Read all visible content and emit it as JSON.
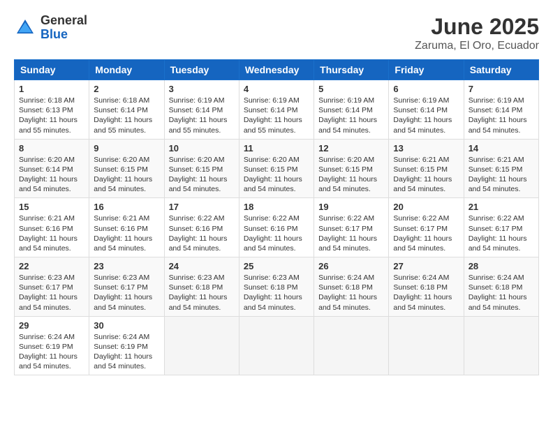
{
  "header": {
    "logo_general": "General",
    "logo_blue": "Blue",
    "month_title": "June 2025",
    "location": "Zaruma, El Oro, Ecuador"
  },
  "days_of_week": [
    "Sunday",
    "Monday",
    "Tuesday",
    "Wednesday",
    "Thursday",
    "Friday",
    "Saturday"
  ],
  "weeks": [
    [
      {
        "day": "1",
        "sunrise": "6:18 AM",
        "sunset": "6:13 PM",
        "daylight": "11 hours and 55 minutes."
      },
      {
        "day": "2",
        "sunrise": "6:18 AM",
        "sunset": "6:14 PM",
        "daylight": "11 hours and 55 minutes."
      },
      {
        "day": "3",
        "sunrise": "6:19 AM",
        "sunset": "6:14 PM",
        "daylight": "11 hours and 55 minutes."
      },
      {
        "day": "4",
        "sunrise": "6:19 AM",
        "sunset": "6:14 PM",
        "daylight": "11 hours and 55 minutes."
      },
      {
        "day": "5",
        "sunrise": "6:19 AM",
        "sunset": "6:14 PM",
        "daylight": "11 hours and 54 minutes."
      },
      {
        "day": "6",
        "sunrise": "6:19 AM",
        "sunset": "6:14 PM",
        "daylight": "11 hours and 54 minutes."
      },
      {
        "day": "7",
        "sunrise": "6:19 AM",
        "sunset": "6:14 PM",
        "daylight": "11 hours and 54 minutes."
      }
    ],
    [
      {
        "day": "8",
        "sunrise": "6:20 AM",
        "sunset": "6:14 PM",
        "daylight": "11 hours and 54 minutes."
      },
      {
        "day": "9",
        "sunrise": "6:20 AM",
        "sunset": "6:15 PM",
        "daylight": "11 hours and 54 minutes."
      },
      {
        "day": "10",
        "sunrise": "6:20 AM",
        "sunset": "6:15 PM",
        "daylight": "11 hours and 54 minutes."
      },
      {
        "day": "11",
        "sunrise": "6:20 AM",
        "sunset": "6:15 PM",
        "daylight": "11 hours and 54 minutes."
      },
      {
        "day": "12",
        "sunrise": "6:20 AM",
        "sunset": "6:15 PM",
        "daylight": "11 hours and 54 minutes."
      },
      {
        "day": "13",
        "sunrise": "6:21 AM",
        "sunset": "6:15 PM",
        "daylight": "11 hours and 54 minutes."
      },
      {
        "day": "14",
        "sunrise": "6:21 AM",
        "sunset": "6:15 PM",
        "daylight": "11 hours and 54 minutes."
      }
    ],
    [
      {
        "day": "15",
        "sunrise": "6:21 AM",
        "sunset": "6:16 PM",
        "daylight": "11 hours and 54 minutes."
      },
      {
        "day": "16",
        "sunrise": "6:21 AM",
        "sunset": "6:16 PM",
        "daylight": "11 hours and 54 minutes."
      },
      {
        "day": "17",
        "sunrise": "6:22 AM",
        "sunset": "6:16 PM",
        "daylight": "11 hours and 54 minutes."
      },
      {
        "day": "18",
        "sunrise": "6:22 AM",
        "sunset": "6:16 PM",
        "daylight": "11 hours and 54 minutes."
      },
      {
        "day": "19",
        "sunrise": "6:22 AM",
        "sunset": "6:17 PM",
        "daylight": "11 hours and 54 minutes."
      },
      {
        "day": "20",
        "sunrise": "6:22 AM",
        "sunset": "6:17 PM",
        "daylight": "11 hours and 54 minutes."
      },
      {
        "day": "21",
        "sunrise": "6:22 AM",
        "sunset": "6:17 PM",
        "daylight": "11 hours and 54 minutes."
      }
    ],
    [
      {
        "day": "22",
        "sunrise": "6:23 AM",
        "sunset": "6:17 PM",
        "daylight": "11 hours and 54 minutes."
      },
      {
        "day": "23",
        "sunrise": "6:23 AM",
        "sunset": "6:17 PM",
        "daylight": "11 hours and 54 minutes."
      },
      {
        "day": "24",
        "sunrise": "6:23 AM",
        "sunset": "6:18 PM",
        "daylight": "11 hours and 54 minutes."
      },
      {
        "day": "25",
        "sunrise": "6:23 AM",
        "sunset": "6:18 PM",
        "daylight": "11 hours and 54 minutes."
      },
      {
        "day": "26",
        "sunrise": "6:24 AM",
        "sunset": "6:18 PM",
        "daylight": "11 hours and 54 minutes."
      },
      {
        "day": "27",
        "sunrise": "6:24 AM",
        "sunset": "6:18 PM",
        "daylight": "11 hours and 54 minutes."
      },
      {
        "day": "28",
        "sunrise": "6:24 AM",
        "sunset": "6:18 PM",
        "daylight": "11 hours and 54 minutes."
      }
    ],
    [
      {
        "day": "29",
        "sunrise": "6:24 AM",
        "sunset": "6:19 PM",
        "daylight": "11 hours and 54 minutes."
      },
      {
        "day": "30",
        "sunrise": "6:24 AM",
        "sunset": "6:19 PM",
        "daylight": "11 hours and 54 minutes."
      },
      null,
      null,
      null,
      null,
      null
    ]
  ]
}
